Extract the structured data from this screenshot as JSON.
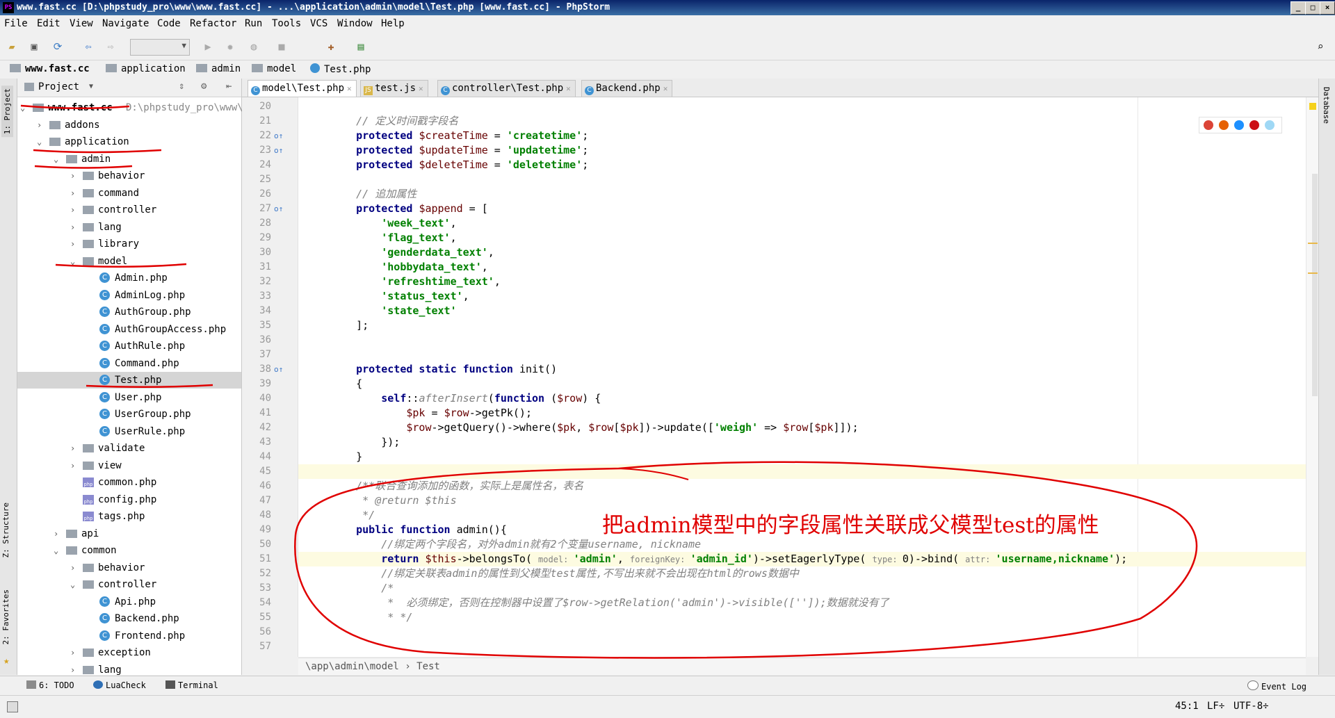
{
  "window": {
    "title": "www.fast.cc [D:\\phpstudy_pro\\www\\www.fast.cc] - ...\\application\\admin\\model\\Test.php [www.fast.cc] - PhpStorm",
    "buttons": [
      "_",
      "□",
      "×"
    ]
  },
  "menu": [
    "File",
    "Edit",
    "View",
    "Navigate",
    "Code",
    "Refactor",
    "Run",
    "Tools",
    "VCS",
    "Window",
    "Help"
  ],
  "breadcrumbs": [
    "www.fast.cc",
    "application",
    "admin",
    "model",
    "Test.php"
  ],
  "left_stripe": {
    "project": "1: Project",
    "structure": "Z: Structure",
    "favorites": "2: Favorites"
  },
  "right_stripe": {
    "database": "Database"
  },
  "project_panel": {
    "title": "Project",
    "root_path": "D:\\phpstudy_pro\\www\\",
    "tree": [
      {
        "label": "www.fast.cc",
        "type": "folder",
        "open": true,
        "depth": 0,
        "bold": true
      },
      {
        "label": "addons",
        "type": "folder",
        "open": false,
        "depth": 1
      },
      {
        "label": "application",
        "type": "folder",
        "open": true,
        "depth": 1
      },
      {
        "label": "admin",
        "type": "folder",
        "open": true,
        "depth": 2
      },
      {
        "label": "behavior",
        "type": "folder",
        "open": false,
        "depth": 3
      },
      {
        "label": "command",
        "type": "folder",
        "open": false,
        "depth": 3
      },
      {
        "label": "controller",
        "type": "folder",
        "open": false,
        "depth": 3
      },
      {
        "label": "lang",
        "type": "folder",
        "open": false,
        "depth": 3
      },
      {
        "label": "library",
        "type": "folder",
        "open": false,
        "depth": 3
      },
      {
        "label": "model",
        "type": "folder",
        "open": true,
        "depth": 3
      },
      {
        "label": "Admin.php",
        "type": "class",
        "depth": 4
      },
      {
        "label": "AdminLog.php",
        "type": "class",
        "depth": 4
      },
      {
        "label": "AuthGroup.php",
        "type": "class",
        "depth": 4
      },
      {
        "label": "AuthGroupAccess.php",
        "type": "class",
        "depth": 4
      },
      {
        "label": "AuthRule.php",
        "type": "class",
        "depth": 4
      },
      {
        "label": "Command.php",
        "type": "class",
        "depth": 4
      },
      {
        "label": "Test.php",
        "type": "class",
        "depth": 4,
        "selected": true
      },
      {
        "label": "User.php",
        "type": "class",
        "depth": 4
      },
      {
        "label": "UserGroup.php",
        "type": "class",
        "depth": 4
      },
      {
        "label": "UserRule.php",
        "type": "class",
        "depth": 4
      },
      {
        "label": "validate",
        "type": "folder",
        "open": false,
        "depth": 3
      },
      {
        "label": "view",
        "type": "folder",
        "open": false,
        "depth": 3
      },
      {
        "label": "common.php",
        "type": "php",
        "depth": 3
      },
      {
        "label": "config.php",
        "type": "php",
        "depth": 3
      },
      {
        "label": "tags.php",
        "type": "php",
        "depth": 3
      },
      {
        "label": "api",
        "type": "folder",
        "open": false,
        "depth": 2
      },
      {
        "label": "common",
        "type": "folder",
        "open": true,
        "depth": 2
      },
      {
        "label": "behavior",
        "type": "folder",
        "open": false,
        "depth": 3
      },
      {
        "label": "controller",
        "type": "folder",
        "open": true,
        "depth": 3
      },
      {
        "label": "Api.php",
        "type": "class",
        "depth": 4
      },
      {
        "label": "Backend.php",
        "type": "class",
        "depth": 4
      },
      {
        "label": "Frontend.php",
        "type": "class",
        "depth": 4
      },
      {
        "label": "exception",
        "type": "folder",
        "open": false,
        "depth": 3
      },
      {
        "label": "lang",
        "type": "folder",
        "open": false,
        "depth": 3
      }
    ]
  },
  "tabs": [
    {
      "label": "model\\Test.php",
      "icon": "C",
      "active": true
    },
    {
      "label": "test.js",
      "icon": "JS",
      "active": false
    },
    {
      "label": "controller\\Test.php",
      "icon": "C",
      "active": false
    },
    {
      "label": "Backend.php",
      "icon": "C",
      "active": false
    }
  ],
  "code_lines": [
    {
      "n": "20",
      "t": [
        {
          "c": "",
          "s": ""
        }
      ]
    },
    {
      "n": "21",
      "t": [
        {
          "c": "cmt",
          "s": "    // 定义时间戳字段名"
        }
      ]
    },
    {
      "n": "22",
      "m": "o↑",
      "t": [
        {
          "c": "kw",
          "s": "    protected "
        },
        {
          "c": "var",
          "s": "$createTime"
        },
        {
          "c": "",
          "s": " = "
        },
        {
          "c": "str",
          "s": "'createtime'"
        },
        {
          "c": "",
          "s": ";"
        }
      ]
    },
    {
      "n": "23",
      "m": "o↑",
      "t": [
        {
          "c": "kw",
          "s": "    protected "
        },
        {
          "c": "var",
          "s": "$updateTime"
        },
        {
          "c": "",
          "s": " = "
        },
        {
          "c": "str",
          "s": "'updatetime'"
        },
        {
          "c": "",
          "s": ";"
        }
      ]
    },
    {
      "n": "24",
      "t": [
        {
          "c": "kw",
          "s": "    protected "
        },
        {
          "c": "var",
          "s": "$deleteTime"
        },
        {
          "c": "",
          "s": " = "
        },
        {
          "c": "str",
          "s": "'deletetime'"
        },
        {
          "c": "",
          "s": ";"
        }
      ]
    },
    {
      "n": "25",
      "t": [
        {
          "c": "",
          "s": ""
        }
      ]
    },
    {
      "n": "26",
      "t": [
        {
          "c": "cmt",
          "s": "    // 追加属性"
        }
      ]
    },
    {
      "n": "27",
      "m": "o↑",
      "t": [
        {
          "c": "kw",
          "s": "    protected "
        },
        {
          "c": "var",
          "s": "$append"
        },
        {
          "c": "",
          "s": " = ["
        }
      ]
    },
    {
      "n": "28",
      "t": [
        {
          "c": "str",
          "s": "        'week_text'"
        },
        {
          "c": "",
          "s": ","
        }
      ]
    },
    {
      "n": "29",
      "t": [
        {
          "c": "str",
          "s": "        'flag_text'"
        },
        {
          "c": "",
          "s": ","
        }
      ]
    },
    {
      "n": "30",
      "t": [
        {
          "c": "str",
          "s": "        'genderdata_text'"
        },
        {
          "c": "",
          "s": ","
        }
      ]
    },
    {
      "n": "31",
      "t": [
        {
          "c": "str",
          "s": "        'hobbydata_text'"
        },
        {
          "c": "",
          "s": ","
        }
      ]
    },
    {
      "n": "32",
      "t": [
        {
          "c": "str",
          "s": "        'refreshtime_text'"
        },
        {
          "c": "",
          "s": ","
        }
      ]
    },
    {
      "n": "33",
      "t": [
        {
          "c": "str",
          "s": "        'status_text'"
        },
        {
          "c": "",
          "s": ","
        }
      ]
    },
    {
      "n": "34",
      "t": [
        {
          "c": "str",
          "s": "        'state_text'"
        }
      ]
    },
    {
      "n": "35",
      "t": [
        {
          "c": "",
          "s": "    ];"
        }
      ]
    },
    {
      "n": "36",
      "t": [
        {
          "c": "",
          "s": ""
        }
      ]
    },
    {
      "n": "37",
      "t": [
        {
          "c": "",
          "s": ""
        }
      ]
    },
    {
      "n": "38",
      "m": "o↑",
      "t": [
        {
          "c": "kw",
          "s": "    protected static function "
        },
        {
          "c": "",
          "s": "init()"
        }
      ]
    },
    {
      "n": "39",
      "t": [
        {
          "c": "",
          "s": "    {"
        }
      ]
    },
    {
      "n": "40",
      "t": [
        {
          "c": "kw",
          "s": "        self"
        },
        {
          "c": "",
          "s": "::"
        },
        {
          "c": "cmt",
          "s": "afterInsert"
        },
        {
          "c": "",
          "s": "("
        },
        {
          "c": "kw",
          "s": "function "
        },
        {
          "c": "",
          "s": "("
        },
        {
          "c": "var",
          "s": "$row"
        },
        {
          "c": "",
          "s": ") {"
        }
      ]
    },
    {
      "n": "41",
      "t": [
        {
          "c": "var",
          "s": "            $pk"
        },
        {
          "c": "",
          "s": " = "
        },
        {
          "c": "var",
          "s": "$row"
        },
        {
          "c": "",
          "s": "->getPk();"
        }
      ]
    },
    {
      "n": "42",
      "t": [
        {
          "c": "var",
          "s": "            $row"
        },
        {
          "c": "",
          "s": "->getQuery()->where("
        },
        {
          "c": "var",
          "s": "$pk"
        },
        {
          "c": "",
          "s": ", "
        },
        {
          "c": "var",
          "s": "$row"
        },
        {
          "c": "",
          "s": "["
        },
        {
          "c": "var",
          "s": "$pk"
        },
        {
          "c": "",
          "s": "])->update(["
        },
        {
          "c": "str",
          "s": "'weigh'"
        },
        {
          "c": "",
          "s": " => "
        },
        {
          "c": "var",
          "s": "$row"
        },
        {
          "c": "",
          "s": "["
        },
        {
          "c": "var",
          "s": "$pk"
        },
        {
          "c": "",
          "s": "]]);"
        }
      ]
    },
    {
      "n": "43",
      "t": [
        {
          "c": "",
          "s": "        });"
        }
      ]
    },
    {
      "n": "44",
      "t": [
        {
          "c": "",
          "s": "    }"
        }
      ]
    },
    {
      "n": "45",
      "hl": true,
      "t": [
        {
          "c": "",
          "s": ""
        }
      ]
    },
    {
      "n": "46",
      "t": [
        {
          "c": "cmt",
          "s": "    /**联合查询添加的函数，实际上是属性名，表名"
        }
      ]
    },
    {
      "n": "47",
      "t": [
        {
          "c": "cmt",
          "s": "     * @return $this"
        }
      ]
    },
    {
      "n": "48",
      "t": [
        {
          "c": "cmt",
          "s": "     */"
        }
      ]
    },
    {
      "n": "49",
      "t": [
        {
          "c": "kw",
          "s": "    public function "
        },
        {
          "c": "",
          "s": "admin(){"
        }
      ]
    },
    {
      "n": "50",
      "t": [
        {
          "c": "cmt",
          "s": "        //绑定两个字段名，对外admin就有2个变量username, nickname"
        }
      ]
    },
    {
      "n": "51",
      "hl": true,
      "t": [
        {
          "c": "kw",
          "s": "        return "
        },
        {
          "c": "var",
          "s": "$this"
        },
        {
          "c": "",
          "s": "->belongsTo( "
        },
        {
          "c": "hint",
          "s": "model: "
        },
        {
          "c": "str",
          "s": "'admin'"
        },
        {
          "c": "",
          "s": ", "
        },
        {
          "c": "hint",
          "s": "foreignKey: "
        },
        {
          "c": "str",
          "s": "'admin_id'"
        },
        {
          "c": "",
          "s": ")->setEagerlyType( "
        },
        {
          "c": "hint",
          "s": "type: "
        },
        {
          "c": "",
          "s": "0)->bind( "
        },
        {
          "c": "hint",
          "s": "attr: "
        },
        {
          "c": "str",
          "s": "'username,nickname'"
        },
        {
          "c": "",
          "s": ");"
        }
      ]
    },
    {
      "n": "52",
      "t": [
        {
          "c": "cmt",
          "s": "        //绑定关联表admin的属性到父模型test属性,不写出来就不会出现在html的rows数据中"
        }
      ]
    },
    {
      "n": "53",
      "t": [
        {
          "c": "cmt",
          "s": "        /*"
        }
      ]
    },
    {
      "n": "54",
      "t": [
        {
          "c": "cmt",
          "s": "         *  必须绑定，否则在控制器中设置了$row->getRelation('admin')->visible(['']);数据就没有了"
        }
      ]
    },
    {
      "n": "55",
      "t": [
        {
          "c": "cmt",
          "s": "         * */"
        }
      ]
    },
    {
      "n": "56",
      "t": [
        {
          "c": "",
          "s": ""
        }
      ]
    },
    {
      "n": "57",
      "t": [
        {
          "c": "",
          "s": ""
        }
      ]
    }
  ],
  "annotation": "把admin模型中的字段属性关联成父模型test的属性",
  "editor_breadcrumb": "\\app\\admin\\model  ›  Test",
  "bottom_tools": [
    {
      "label": "6: TODO",
      "icon": "todo-icon"
    },
    {
      "label": "LuaCheck",
      "icon": "luacheck-icon"
    },
    {
      "label": "Terminal",
      "icon": "terminal-icon"
    },
    {
      "label": "Event Log",
      "icon": "event-log-icon"
    }
  ],
  "status": {
    "position": "45:1",
    "line_sep": "LF÷",
    "encoding": "UTF-8÷"
  },
  "colors": {
    "title_bg": "#0a246a",
    "keyword": "#000080",
    "string": "#008000",
    "variable": "#660000",
    "annotation": "#e00000"
  }
}
